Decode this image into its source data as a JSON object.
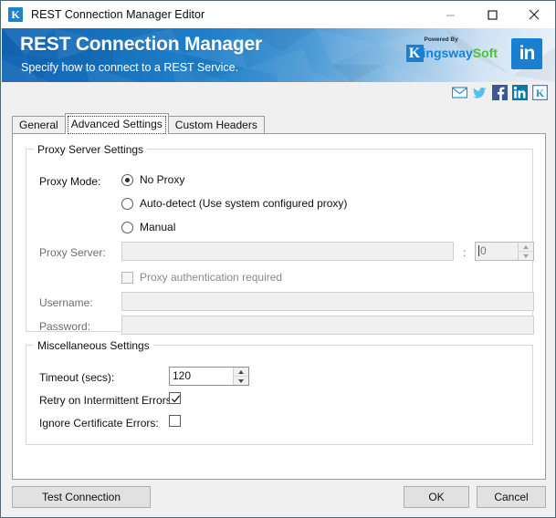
{
  "window": {
    "title": "REST Connection Manager Editor",
    "app_icon": "kingswaysoft-k-icon",
    "controls": {
      "minimize": "minimize-icon",
      "maximize": "maximize-icon",
      "close": "close-icon"
    }
  },
  "banner": {
    "title": "REST Connection Manager",
    "subtitle": "Specify how to connect to a REST Service.",
    "logo": {
      "powered_by": "Powered By",
      "k": "K",
      "name_part1": "ingsway",
      "name_part2": "Soft"
    },
    "linkedin_badge": "in",
    "colors": {
      "banner_blue": "#1566b5",
      "banner_fade": "#eaf3fb",
      "brand_blue": "#1b7fd1",
      "brand_green": "#4fbf3a"
    }
  },
  "social": {
    "items": [
      {
        "name": "email-icon",
        "title": "Email"
      },
      {
        "name": "twitter-icon",
        "title": "Twitter"
      },
      {
        "name": "facebook-icon",
        "title": "Facebook"
      },
      {
        "name": "linkedin-icon",
        "title": "LinkedIn"
      },
      {
        "name": "kingswaysoft-icon",
        "title": "KingswaySoft"
      }
    ]
  },
  "tabs": [
    {
      "label": "General",
      "selected": false
    },
    {
      "label": "Advanced Settings",
      "selected": true
    },
    {
      "label": "Custom Headers",
      "selected": false
    }
  ],
  "proxy_group": {
    "title": "Proxy Server Settings",
    "proxy_mode_label": "Proxy Mode:",
    "options": [
      {
        "label": "No Proxy",
        "checked": true
      },
      {
        "label": "Auto-detect (Use system configured proxy)",
        "checked": false
      },
      {
        "label": "Manual",
        "checked": false
      }
    ],
    "proxy_server_label": "Proxy Server:",
    "proxy_server_value": "",
    "port_separator": ":",
    "port_value": "0",
    "proxy_auth_label": "Proxy authentication required",
    "proxy_auth_checked": false,
    "username_label": "Username:",
    "username_value": "",
    "password_label": "Password:",
    "password_value": ""
  },
  "misc_group": {
    "title": "Miscellaneous Settings",
    "timeout_label": "Timeout (secs):",
    "timeout_value": "120",
    "retry_label": "Retry on Intermittent Errors:",
    "retry_checked": true,
    "ignore_cert_label": "Ignore Certificate Errors:",
    "ignore_cert_checked": false
  },
  "footer": {
    "test_connection": "Test Connection",
    "ok": "OK",
    "cancel": "Cancel"
  }
}
